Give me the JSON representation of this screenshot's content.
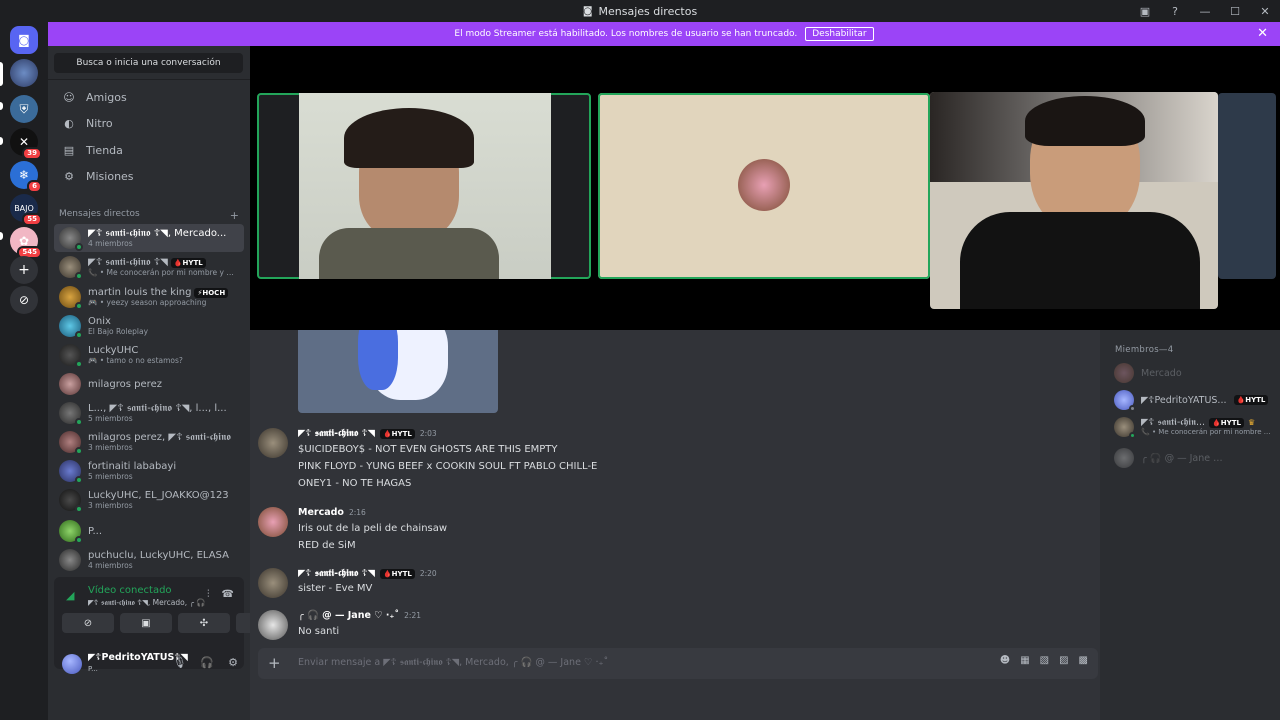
{
  "window": {
    "title": "Mensajes directos"
  },
  "banner": {
    "text": "El modo Streamer está habilitado. Los nombres de usuario se han truncado.",
    "button": "Deshabilitar"
  },
  "servers": {
    "badges": [
      "39",
      "6",
      "55",
      "545"
    ]
  },
  "sidebar": {
    "search": "Busca o inicia una conversación",
    "nav": [
      {
        "label": "Amigos",
        "icon": "friends-icon"
      },
      {
        "label": "Nitro",
        "icon": "nitro-icon"
      },
      {
        "label": "Tienda",
        "icon": "shop-icon"
      },
      {
        "label": "Misiones",
        "icon": "quests-icon"
      }
    ],
    "dm_header": "Mensajes directos",
    "dms": [
      {
        "name": "◤☦ 𝖘𝖆𝖓𝖙𝖎-𝖈𝖍𝖎𝖓𝖔 ☦◥, Mercado...",
        "sub": "4 miembros",
        "tag": ""
      },
      {
        "name": "◤☦ 𝖘𝖆𝖓𝖙𝖎-𝖈𝖍𝖎𝖓𝖔 ☦◥",
        "sub": "📞 • Me conocerán por mi nombre y mis ...",
        "tag": "🩸HYTL"
      },
      {
        "name": "martin louis the king",
        "sub": "🎮 • yeezy season approaching",
        "tag": "⚡HOCH"
      },
      {
        "name": "Onix",
        "sub": "El Bajo Roleplay",
        "tag": ""
      },
      {
        "name": "LuckyUHC",
        "sub": "🎮 • tamo o no estamos?",
        "tag": ""
      },
      {
        "name": "milagros perez",
        "sub": "",
        "tag": ""
      },
      {
        "name": "L..., ◤☦ 𝖘𝖆𝖓𝖙𝖎-𝖈𝖍𝖎𝖓𝖔 ☦◥, l..., l...",
        "sub": "5 miembros",
        "tag": ""
      },
      {
        "name": "milagros perez, ◤☦ 𝖘𝖆𝖓𝖙𝖎-𝖈𝖍𝖎𝖓𝖔",
        "sub": "3 miembros",
        "tag": ""
      },
      {
        "name": "fortinaiti lababayi",
        "sub": "5 miembros",
        "tag": ""
      },
      {
        "name": "LuckyUHC, EL_JOAKKO@123",
        "sub": "3 miembros",
        "tag": ""
      },
      {
        "name": "P...",
        "sub": "",
        "tag": ""
      },
      {
        "name": "puchuclu, LuckyUHC, ELASA",
        "sub": "4 miembros",
        "tag": ""
      }
    ]
  },
  "voice": {
    "status": "Vídeo conectado",
    "channel": "◤☦ 𝖘𝖆𝖓𝖙𝖎-𝖈𝖍𝖎𝖓𝖔 ☦◥, Mercado, ╭ 🎧 @ ..."
  },
  "user": {
    "name": "◤☦PedritoYATUS☦◥",
    "status": "P..."
  },
  "chat": {
    "messages": [
      {
        "author": "◤☦ 𝖘𝖆𝖓𝖙𝖎-𝖈𝖍𝖎𝖓𝖔 ☦◥",
        "tag": "🩸HYTL",
        "time": "2:03",
        "lines": [
          "$UICIDEBOY$ - NOT EVEN GHOSTS ARE THIS EMPTY",
          "PINK FLOYD - YUNG BEEF x COOKIN SOUL FT PABLO CHILL-E",
          "ONEY1 - NO TE HAGAS"
        ]
      },
      {
        "author": "Mercado",
        "tag": "",
        "time": "2:16",
        "lines": [
          "Iris out de la peli de chainsaw",
          "RED de SiM"
        ]
      },
      {
        "author": "◤☦ 𝖘𝖆𝖓𝖙𝖎-𝖈𝖍𝖎𝖓𝖔 ☦◥",
        "tag": "🩸HYTL",
        "time": "2:20",
        "lines": [
          "sister - Eve MV"
        ]
      },
      {
        "author": "╭ 🎧 @ — Jane ♡ ‧₊˚",
        "tag": "",
        "time": "2:21",
        "lines": [
          "No santi"
        ]
      }
    ],
    "composer_placeholder": "Enviar mensaje a ◤☦ 𝖘𝖆𝖓𝖙𝖎-𝖈𝖍𝖎𝖓𝖔 ☦◥, Mercado, ╭ 🎧 @ — Jane ♡ ‧₊˚"
  },
  "members": {
    "header": "Miembros—4",
    "list": [
      {
        "name": "Mercado",
        "sub": "",
        "tag": "",
        "status_color": "#80848e"
      },
      {
        "name": "◤☦PedritoYATUS...",
        "sub": "",
        "tag": "🩸HYTL",
        "status_color": "#80848e"
      },
      {
        "name": "◤☦ 𝖘𝖆𝖓𝖙𝖎-𝖈𝖍𝖎𝖓...",
        "sub": "📞 • Me conocerán por mi nombre ...",
        "tag": "🩸HYTL",
        "status_color": "#23a55a"
      },
      {
        "name": "╭ 🎧 @ — Jane ♡ ‧₊˚",
        "sub": "",
        "tag": "",
        "status_color": "#80848e"
      }
    ]
  },
  "colors": {
    "accent": "#9b44f7",
    "online": "#23a55a",
    "badge": "#f23f43",
    "brand": "#5865f2"
  }
}
